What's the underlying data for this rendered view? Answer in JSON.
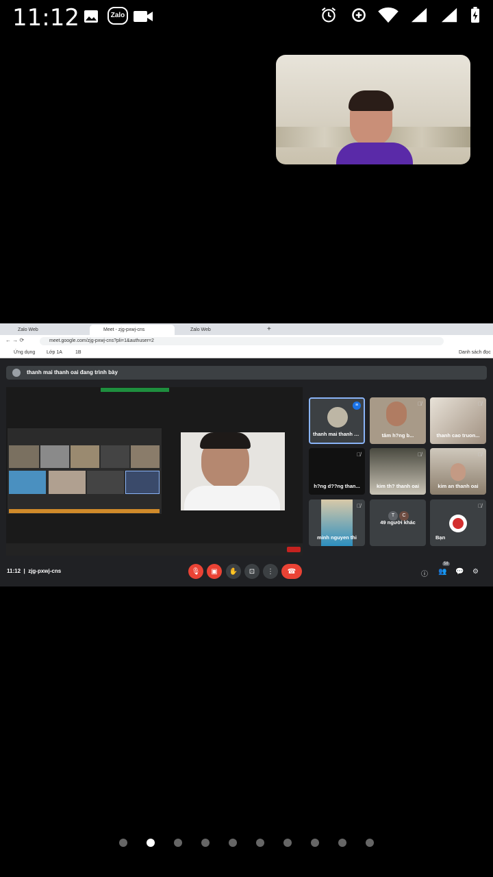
{
  "status_bar": {
    "time": "11:12",
    "left_icons": [
      "image-icon",
      "zalo-icon",
      "video-icon"
    ],
    "zalo_label": "Zalo",
    "right_icons": [
      "alarm-icon",
      "data-saver-icon",
      "wifi-icon",
      "signal-icon",
      "signal-icon-2",
      "battery-charging-icon"
    ]
  },
  "browser": {
    "tabs": [
      {
        "label": "Zalo Web",
        "active": false
      },
      {
        "label": "Meet - zjg-pxwj-cns",
        "active": true
      },
      {
        "label": "Zalo Web",
        "active": false
      }
    ],
    "url": "meet.google.com/zjg-pxwj-cns?pli=1&authuser=2",
    "bookmarks": [
      "Ứng dụng",
      "Lớp 1A",
      "1B"
    ],
    "reading_list": "Danh sách đọc"
  },
  "meet": {
    "presenting_banner": "thanh mai thanh oai đang trình bày",
    "participants": [
      {
        "name": "thanh mai thanh oai",
        "speaking": true,
        "muted": false
      },
      {
        "name": "tâm h?ng b... ",
        "muted": true
      },
      {
        "name": "thanh cao truon...",
        "muted": true
      },
      {
        "name": "h?ng d??ng than...",
        "muted": true
      },
      {
        "name": "kim th? thanh oai",
        "muted": true
      },
      {
        "name": "kim an thanh oai",
        "muted": true
      },
      {
        "name": "minh nguyen thi",
        "muted": true
      },
      {
        "name": "49 người khác",
        "muted": false,
        "avatars": [
          "T",
          "C"
        ]
      },
      {
        "name": "Bạn",
        "muted": true
      }
    ],
    "meeting_time": "11:12",
    "meeting_code": "zjg-pxwj-cns",
    "badge_count": "58",
    "colors": {
      "red": "#ea4335",
      "bg": "#202124",
      "tile": "#3c4043",
      "accent": "#8ab4f8"
    }
  },
  "page_indicator": {
    "count": 10,
    "active_index": 1
  }
}
